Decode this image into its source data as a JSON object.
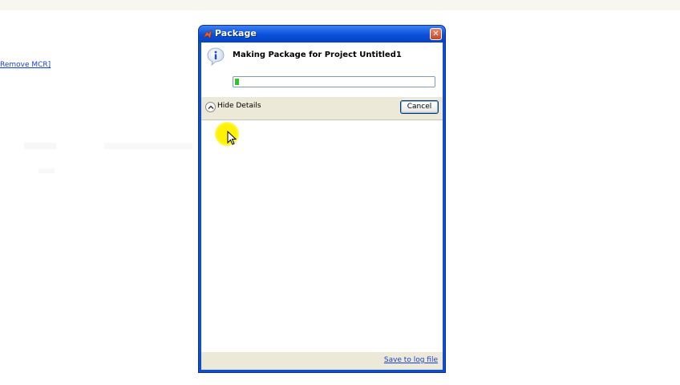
{
  "background": {
    "link_text": "Remove MCR]"
  },
  "dialog": {
    "title": "Package",
    "close_symbol": "✕",
    "message": "Making Package for Project Untitled1",
    "progress_fraction": 0.02,
    "toggle_label": "Hide Details",
    "cancel_label": "Cancel",
    "save_log_label": "Save to log file",
    "icons": {
      "title": "matlab-logo-icon",
      "info": "info-icon",
      "toggle": "chevron-up-icon"
    }
  },
  "colors": {
    "titlebar": "#0a4fd9",
    "progress": "#31c431",
    "link": "#1a3fd6",
    "highlight": "#fff200"
  }
}
